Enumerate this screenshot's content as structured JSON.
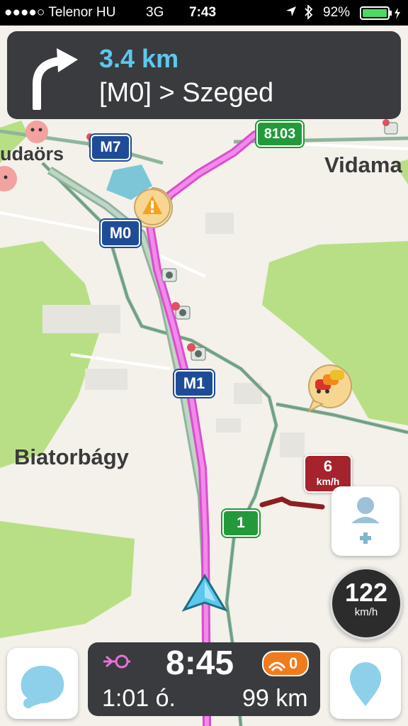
{
  "status_bar": {
    "carrier": "●●●●○ Telenor HU",
    "network": "3G",
    "time": "7:43",
    "battery": "92%"
  },
  "navigation": {
    "distance": "3.4 km",
    "destination": "[M0] > Szeged",
    "turn_icon": "turn-right-arrow-icon"
  },
  "map": {
    "places": [
      "udaörs",
      "Vidama",
      "Biatorbágy"
    ],
    "road_shields": {
      "m7": "M7",
      "m0": "M0",
      "m1": "M1",
      "r8103": "8103",
      "r1": "1"
    },
    "speed_report": {
      "value": "6",
      "unit": "km/h"
    },
    "colors": {
      "route": "#ee6fe3",
      "park": "#b8df86",
      "motorway_shield": "#1f4c97",
      "road_shield": "#229a3a",
      "alert": "#f4a11f"
    }
  },
  "speedometer": {
    "value": "122",
    "unit": "km/h"
  },
  "trip": {
    "eta": "8:45",
    "duration": "1:01 ó.",
    "distance_left": "99 km",
    "traffic_count": "0"
  },
  "icons": {
    "add_contact": "person-plus-icon",
    "menu": "waze-chat-icon",
    "pin": "location-pin-icon"
  }
}
